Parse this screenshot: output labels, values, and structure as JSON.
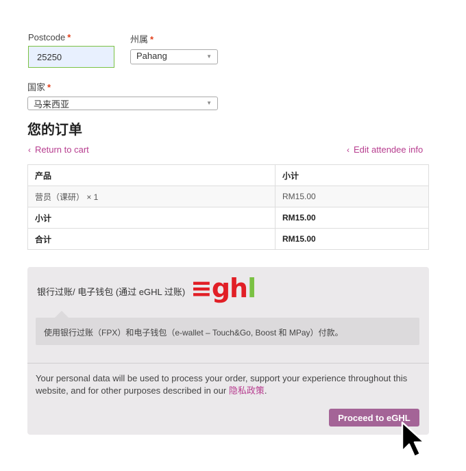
{
  "form": {
    "postcode": {
      "label": "Postcode",
      "required": "*",
      "value": "25250"
    },
    "state": {
      "label": "州属",
      "required": "*",
      "value": "Pahang",
      "arrow": "▼"
    },
    "country": {
      "label": "国家",
      "required": "*",
      "value": "马来西亚",
      "arrow": "▼"
    }
  },
  "order": {
    "title": "您的订单",
    "return_link": "Return to cart",
    "edit_link": "Edit attendee info",
    "chevron": "‹",
    "table": {
      "header": {
        "product": "产品",
        "subtotal": "小计"
      },
      "item": {
        "name": "营员（课研） × 1",
        "price": "RM15.00"
      },
      "subtotal_row": {
        "label": "小计",
        "value": "RM15.00"
      },
      "total_row": {
        "label": "合计",
        "value": "RM15.00"
      }
    }
  },
  "payment": {
    "method_label": "银行过账/ 电子钱包 (通过 eGHL 过账)",
    "logo": {
      "eq": "≡",
      "gh": "gh",
      "l": "l"
    },
    "description": "使用银行过账（FPX）和电子钱包（e-wallet – Touch&Go, Boost 和 MPay）付款。",
    "privacy_text": "Your personal data will be used to process your order, support your experience throughout this website, and for other purposes described in our ",
    "privacy_link": "隐私政策",
    "privacy_end": ".",
    "proceed_label": "Proceed to eGHL"
  },
  "colors": {
    "accent": "#a46497",
    "link": "#b73d8f",
    "required": "#e2401c",
    "logo_red": "#e11f26",
    "logo_green": "#7ac143"
  },
  "icons": [
    "chevron-left-icon",
    "dropdown-arrow-icon",
    "eghl-logo",
    "mouse-cursor-icon"
  ]
}
